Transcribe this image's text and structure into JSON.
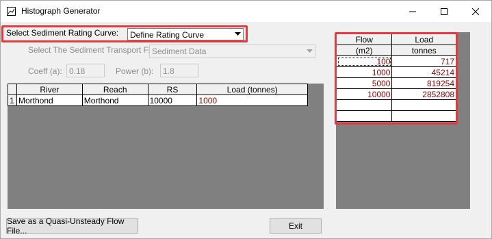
{
  "window": {
    "title": "Histograph Generator",
    "icon": "app-chart-icon",
    "controls": [
      "minimize-icon",
      "maximize-icon",
      "close-icon"
    ]
  },
  "rating_curve": {
    "label": "Select Sediment Rating Curve:",
    "selected": "Define Rating Curve"
  },
  "transport_file": {
    "label": "Select The Sediment Transport File:",
    "selected": "Sediment Data"
  },
  "coeff": {
    "label": "Coeff (a):",
    "value": "0.18"
  },
  "power": {
    "label": "Power (b):",
    "value": "1.8"
  },
  "left_grid": {
    "headers": [
      "River",
      "Reach",
      "RS",
      "Load (tonnes)"
    ],
    "rows": [
      {
        "index": "1",
        "river": "Morthond",
        "reach": "Morthond",
        "rs": "10000",
        "load": "1000"
      }
    ]
  },
  "right_grid": {
    "header_row1": [
      "Flow",
      "Load"
    ],
    "header_row2": [
      "(m2)",
      "tonnes"
    ],
    "rows": [
      {
        "flow": "100",
        "load": "717"
      },
      {
        "flow": "1000",
        "load": "45214"
      },
      {
        "flow": "5000",
        "load": "819254"
      },
      {
        "flow": "10000",
        "load": "2852808"
      },
      {
        "flow": "",
        "load": ""
      },
      {
        "flow": "",
        "load": ""
      }
    ]
  },
  "buttons": {
    "save": "Save as a Quasi-Unsteady Flow File...",
    "exit": "Exit"
  },
  "colors": {
    "highlight": "#e6393f",
    "value_text": "#8b0000",
    "grid_background": "#808080"
  }
}
